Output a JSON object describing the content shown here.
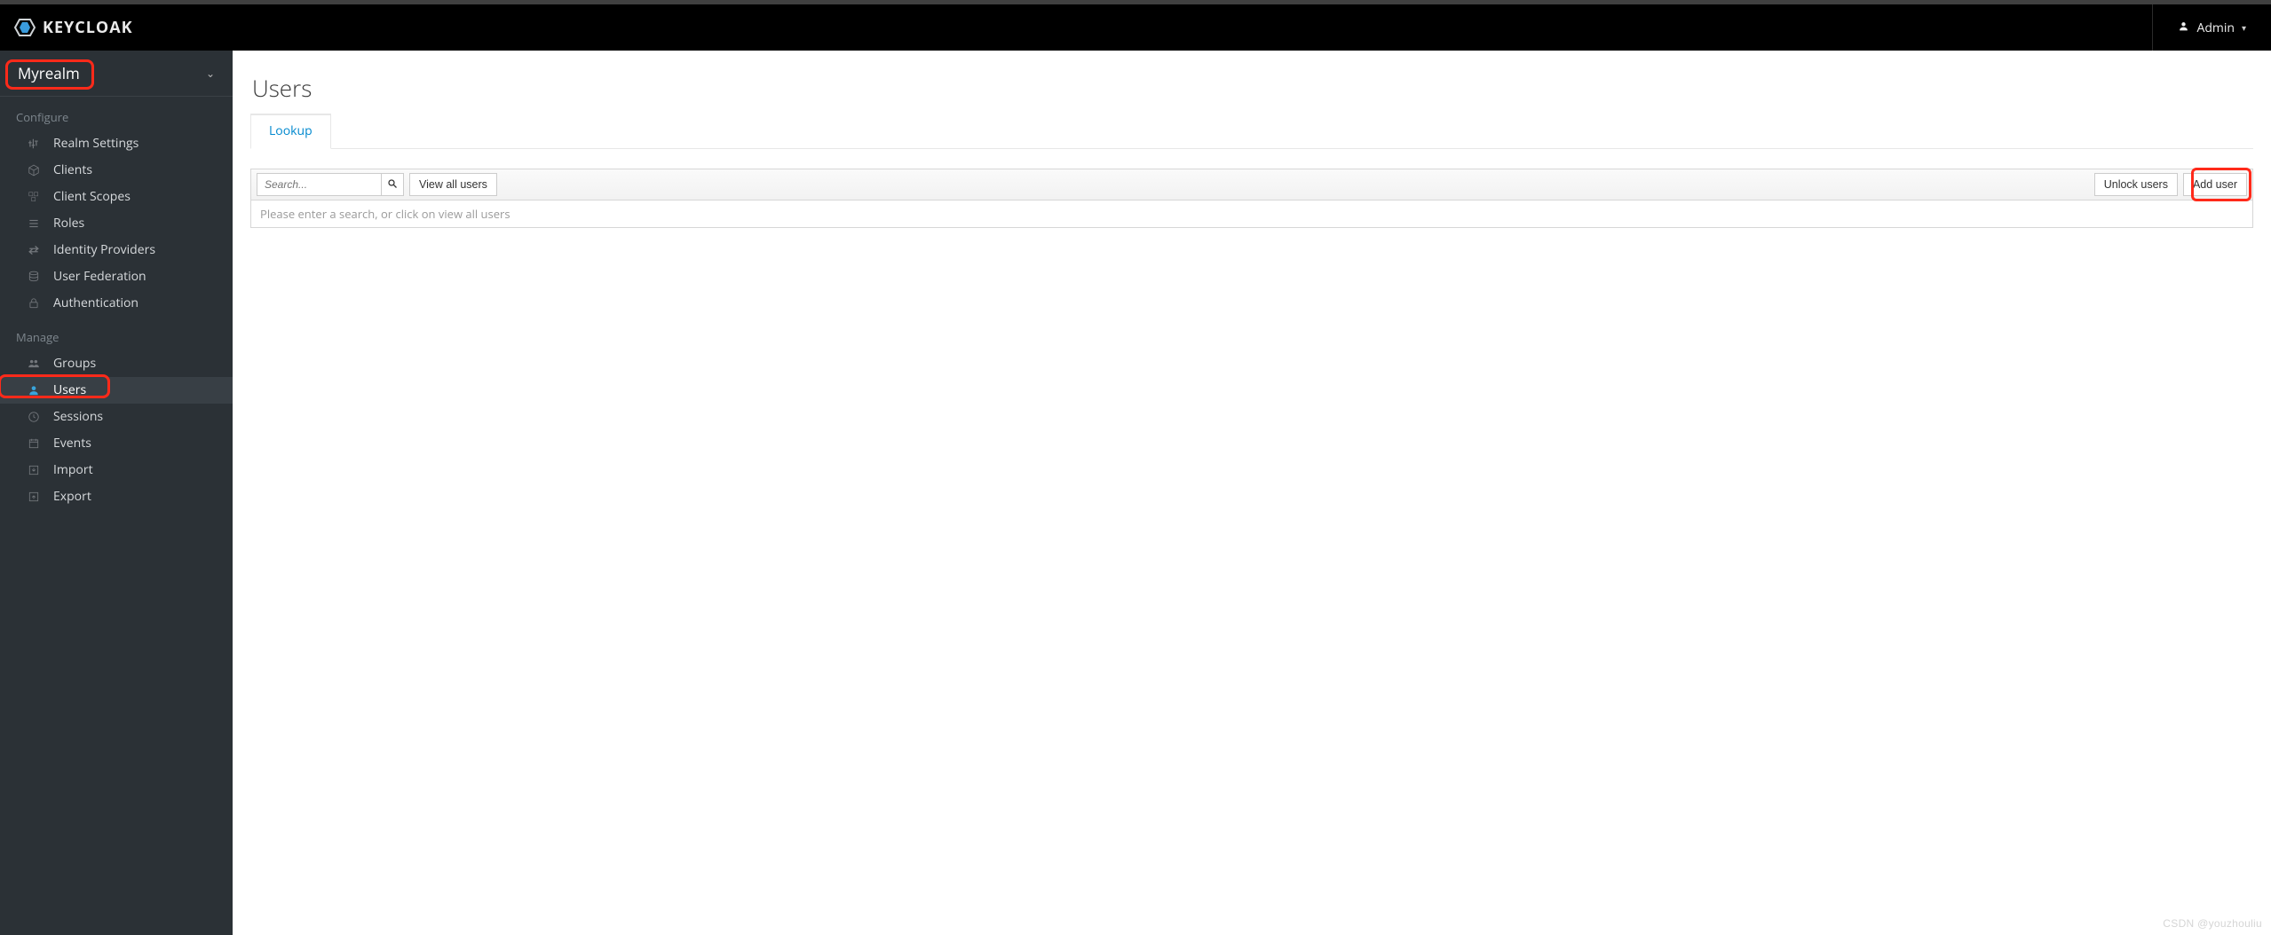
{
  "brand": {
    "name": "KEYCLOAK"
  },
  "header": {
    "user_label": "Admin"
  },
  "sidebar": {
    "realm": "Myrealm",
    "sections": [
      {
        "title": "Configure",
        "items": [
          {
            "id": "realm-settings",
            "label": "Realm Settings",
            "icon": "sliders-icon"
          },
          {
            "id": "clients",
            "label": "Clients",
            "icon": "cube-icon"
          },
          {
            "id": "client-scopes",
            "label": "Client Scopes",
            "icon": "cubes-icon"
          },
          {
            "id": "roles",
            "label": "Roles",
            "icon": "list-icon"
          },
          {
            "id": "identity-providers",
            "label": "Identity Providers",
            "icon": "exchange-icon"
          },
          {
            "id": "user-federation",
            "label": "User Federation",
            "icon": "database-icon"
          },
          {
            "id": "authentication",
            "label": "Authentication",
            "icon": "lock-icon"
          }
        ]
      },
      {
        "title": "Manage",
        "items": [
          {
            "id": "groups",
            "label": "Groups",
            "icon": "group-icon"
          },
          {
            "id": "users",
            "label": "Users",
            "icon": "user-icon",
            "active": true
          },
          {
            "id": "sessions",
            "label": "Sessions",
            "icon": "clock-icon"
          },
          {
            "id": "events",
            "label": "Events",
            "icon": "calendar-icon"
          },
          {
            "id": "import",
            "label": "Import",
            "icon": "import-icon"
          },
          {
            "id": "export",
            "label": "Export",
            "icon": "export-icon"
          }
        ]
      }
    ]
  },
  "page": {
    "title": "Users",
    "tabs": [
      {
        "id": "lookup",
        "label": "Lookup",
        "active": true
      }
    ],
    "search_placeholder": "Search...",
    "view_all_label": "View all users",
    "unlock_label": "Unlock users",
    "add_user_label": "Add user",
    "hint": "Please enter a search, or click on view all users"
  },
  "watermark": "CSDN @youzhouliu"
}
